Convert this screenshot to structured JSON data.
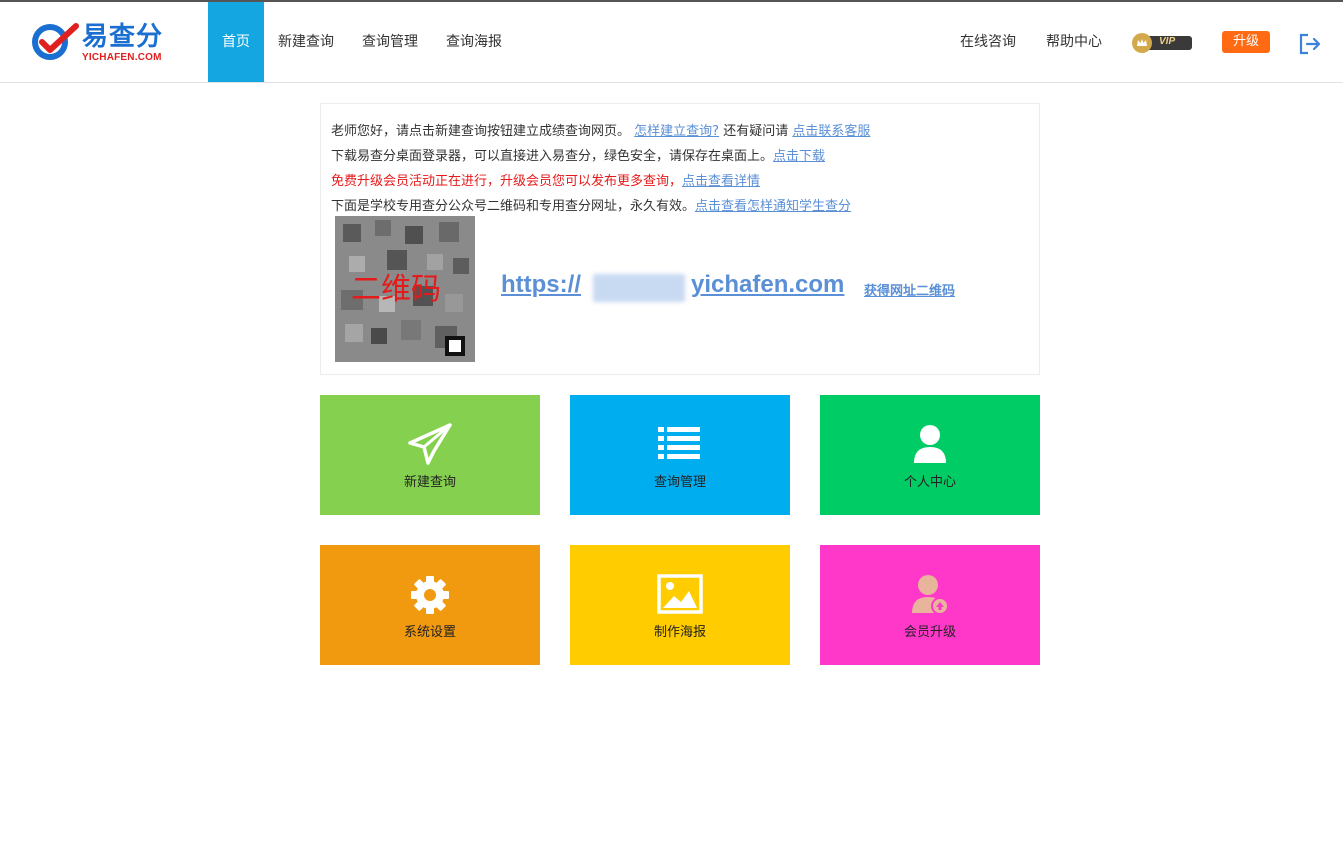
{
  "brand": {
    "name": "易查分",
    "sub": "YICHAFEN.COM",
    "blue": "#1a6fd0",
    "red": "#e02020"
  },
  "nav": {
    "items": [
      "首页",
      "新建查询",
      "查询管理",
      "查询海报"
    ],
    "active_color": "#14a6e0"
  },
  "right_nav": {
    "consult": "在线咨询",
    "help": "帮助中心",
    "vip": "VIP",
    "upgrade": "升级",
    "upgrade_color": "#ff6a13",
    "logout_icon": "logout-icon"
  },
  "notice": {
    "line1_text": "老师您好，请点击新建查询按钮建立成绩查询网页。",
    "line1_link": "怎样建立查询?",
    "line1_mid": "还有疑问请",
    "line1_link2": "点击联系客服",
    "line2_text": "下载易查分桌面登录器，可以直接进入易查分，绿色安全，请保存在桌面上。",
    "line2_link": "点击下载",
    "line3_text": "免费升级会员活动正在进行，升级会员您可以发布更多查询，",
    "line3_link": "点击查看详情",
    "line4_text": "下面是学校专用查分公众号二维码和专用查分网址，永久有效。",
    "line4_link": "点击查看怎样通知学生查分",
    "qr_label": "二维码",
    "url_prefix": "https://",
    "url_suffix": "yichafen.com",
    "qr_link": "获得网址二维码"
  },
  "tiles": [
    {
      "label": "新建查询",
      "icon": "paper-plane-icon",
      "color": "#85d14f"
    },
    {
      "label": "查询管理",
      "icon": "list-icon",
      "color": "#00aeef"
    },
    {
      "label": "个人中心",
      "icon": "user-icon",
      "color": "#00cc66"
    },
    {
      "label": "系统设置",
      "icon": "gear-icon",
      "color": "#f29a0f"
    },
    {
      "label": "制作海报",
      "icon": "image-icon",
      "color": "#ffcc00"
    },
    {
      "label": "会员升级",
      "icon": "member-upgrade-icon",
      "color": "#ff38c9"
    }
  ]
}
